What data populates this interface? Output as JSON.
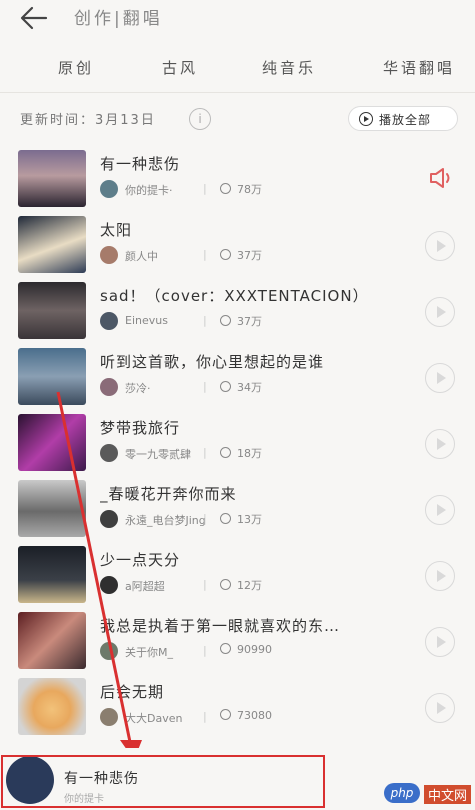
{
  "header": {
    "title": "创作|翻唱"
  },
  "tabs": [
    "原创",
    "古风",
    "纯音乐",
    "华语翻唱"
  ],
  "update_time": "更新时间：3月13日",
  "play_all_label": "播放全部",
  "songs": [
    {
      "title": "有一种悲伤",
      "author": "你的提卡·",
      "plays": "78万",
      "playing": true
    },
    {
      "title": "太阳",
      "author": "颜人中",
      "plays": "37万"
    },
    {
      "title": "sad！（cover：XXXTENTACION）",
      "author": "Einevus",
      "plays": "37万"
    },
    {
      "title": "听到这首歌，你心里想起的是谁",
      "author": "莎冷·",
      "plays": "34万"
    },
    {
      "title": "梦带我旅行",
      "author": "零一九零贰肆",
      "plays": "18万"
    },
    {
      "title": "_春暖花开奔你而来",
      "author": "永遠_电台梦Jing",
      "plays": "13万"
    },
    {
      "title": "少一点天分",
      "author": "a阿超超",
      "plays": "12万"
    },
    {
      "title": "我总是执着于第一眼就喜欢的东…",
      "author": "关于你M_",
      "plays": "90990"
    },
    {
      "title": "后会无期",
      "author": "大大Daven",
      "plays": "73080"
    }
  ],
  "mini_player": {
    "title": "有一种悲伤",
    "author": "你的提卡"
  },
  "watermark": {
    "badge": "php",
    "text": "中文网"
  },
  "colors": {
    "accent_red": "#d93030",
    "speaker": "#e06060"
  }
}
